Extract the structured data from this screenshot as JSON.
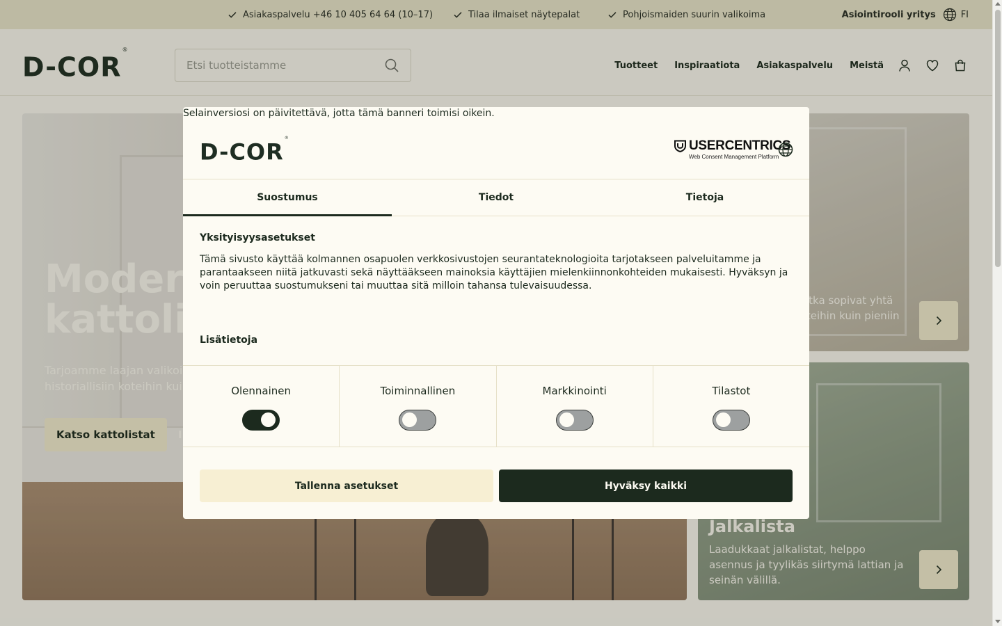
{
  "topbar": {
    "usps": [
      "Asiakaspalvelu +46 10 405 64 64 (10–17)",
      "Tilaa ilmaiset näytepalat",
      "Pohjoismaiden suurin valikoima"
    ],
    "role": "Asiointirooli yritys",
    "language": "FI"
  },
  "header": {
    "logo": "D-COR",
    "logo_mark": "®",
    "search_placeholder": "Etsi tuotteistamme",
    "nav": [
      "Tuotteet",
      "Inspiraatiota",
      "Asiakaspalvelu",
      "Meistä"
    ],
    "icons": [
      "user-icon",
      "heart-icon",
      "bag-icon"
    ]
  },
  "hero": {
    "title_line1": "Moderni",
    "title_line2": "kattolistat",
    "text_line1": "Tarjoamme laajan valikoiman",
    "text_line2": "historiallisiin koteihin kuin u",
    "primary_button": "Katso kattolistat",
    "secondary_button": "I"
  },
  "cards": [
    {
      "text_line1": "otka sopivat yhtä",
      "text_line2": "tteihin kuin pieniin"
    },
    {
      "title": "Jalkalista",
      "text": "Laadukkaat jalkalistat, helppo asennus ja tyylikäs siirtymä lattian ja seinän välillä."
    }
  ],
  "consent": {
    "browser_warning": "Selainversiosi on päivitettävä, jotta tämä banneri toimisi oikein.",
    "logo": "D-COR",
    "logo_mark": "®",
    "provider_name": "USERCENTRICS",
    "provider_sub": "Web Consent Management Platform",
    "tabs": [
      "Suostumus",
      "Tiedot",
      "Tietoja"
    ],
    "active_tab": 0,
    "privacy_title": "Yksityisyysasetukset",
    "privacy_text": "Tämä sivusto käyttää kolmannen osapuolen verkkosivustojen seurantateknologioita tarjotakseen palveluitamme ja parantaakseen niitä jatkuvasti sekä näyttääkseen mainoksia käyttäjien mielenkiinnonkohteiden mukaisesti. Hyväksyn ja voin peruuttaa suostumukseni tai muuttaa sitä milloin tahansa tulevaisuudessa.",
    "more_title": "Lisätietoja",
    "categories": [
      {
        "label": "Olennainen",
        "enabled": true
      },
      {
        "label": "Toiminnallinen",
        "enabled": false
      },
      {
        "label": "Markkinointi",
        "enabled": false
      },
      {
        "label": "Tilastot",
        "enabled": false
      }
    ],
    "save_button": "Tallenna asetukset",
    "accept_button": "Hyväksy kaikki"
  },
  "colors": {
    "brand_dark": "#1c2a1e",
    "cream": "#fdfbf3",
    "accent_light": "#f7efd3",
    "topbar_bg": "#e9e6cc"
  }
}
